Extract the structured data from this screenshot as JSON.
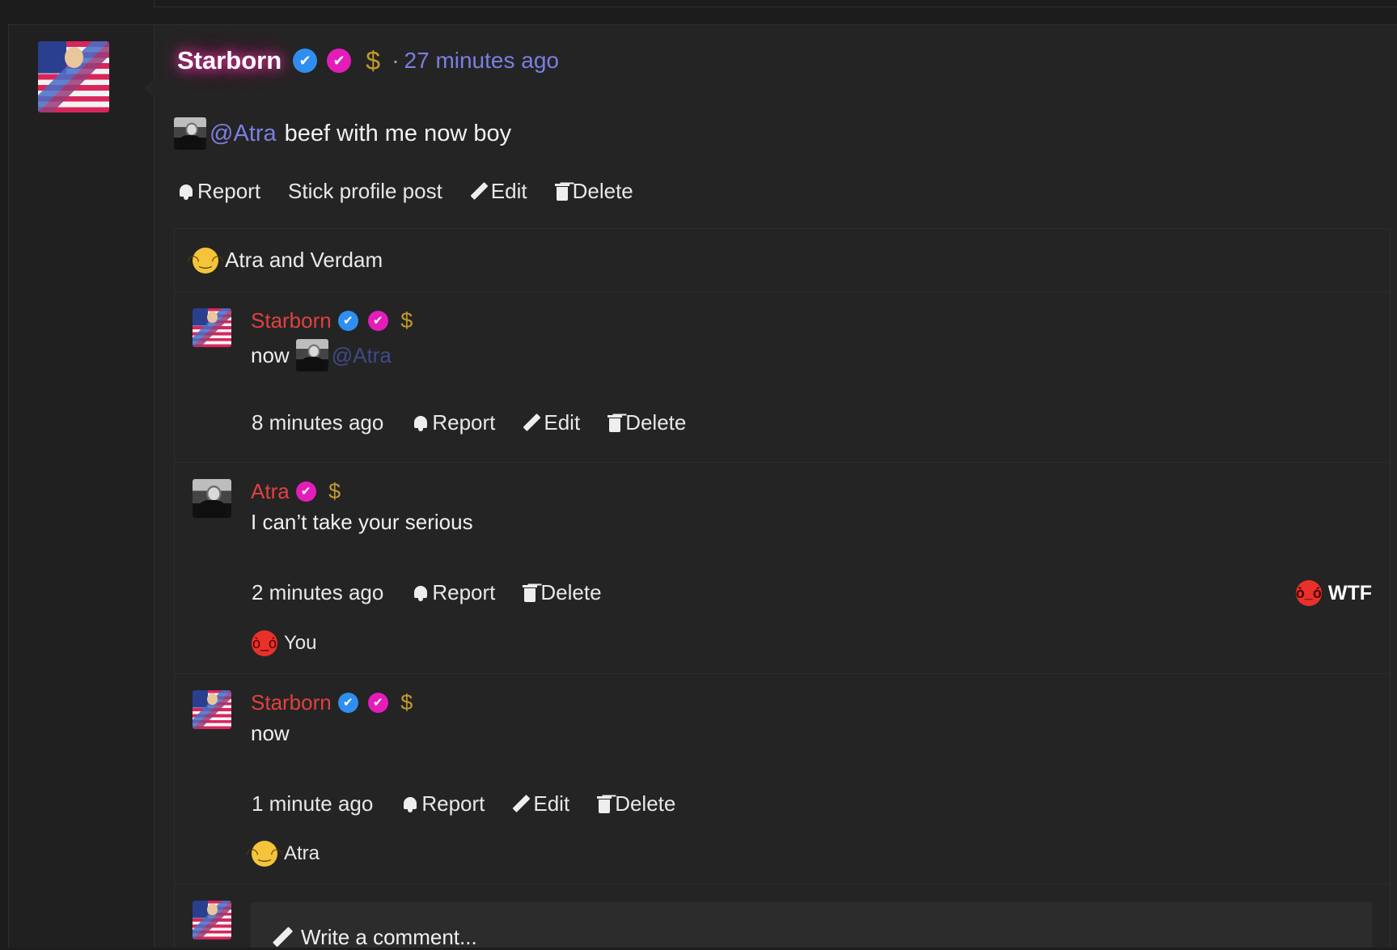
{
  "post": {
    "author": "Starborn",
    "time": "27 minutes ago",
    "time_separator": "·",
    "mention": "@Atra",
    "body": "beef with me now boy",
    "actions": {
      "report": "Report",
      "stick": "Stick profile post",
      "edit": "Edit",
      "delete": "Delete"
    }
  },
  "reactions_summary": {
    "emoji": "laugh-cry",
    "text": "Atra and Verdam"
  },
  "badges": {
    "verified": "✔",
    "pink": "✔",
    "dollar": "$"
  },
  "comments": [
    {
      "author": "Starborn",
      "text": "now",
      "mention": "@Atra",
      "time": "8 minutes ago",
      "report": "Report",
      "edit": "Edit",
      "delete": "Delete"
    },
    {
      "author": "Atra",
      "text": "I can’t take your serious",
      "time": "2 minutes ago",
      "report": "Report",
      "delete": "Delete",
      "reaction_label": "WTF",
      "reacted_by": "You"
    },
    {
      "author": "Starborn",
      "text": "now",
      "time": "1 minute ago",
      "report": "Report",
      "edit": "Edit",
      "delete": "Delete",
      "reacted_by": "Atra"
    }
  ],
  "composer": {
    "placeholder": "Write a comment..."
  },
  "colors": {
    "background": "#1c1c1c",
    "panel": "#242424",
    "username_red": "#e2403f",
    "link": "#7b7fe0",
    "verified_blue": "#2f8ff0",
    "badge_pink": "#e41dba",
    "dollar_gold": "#c49a2c",
    "glow_pink": "#ff3ab8"
  }
}
